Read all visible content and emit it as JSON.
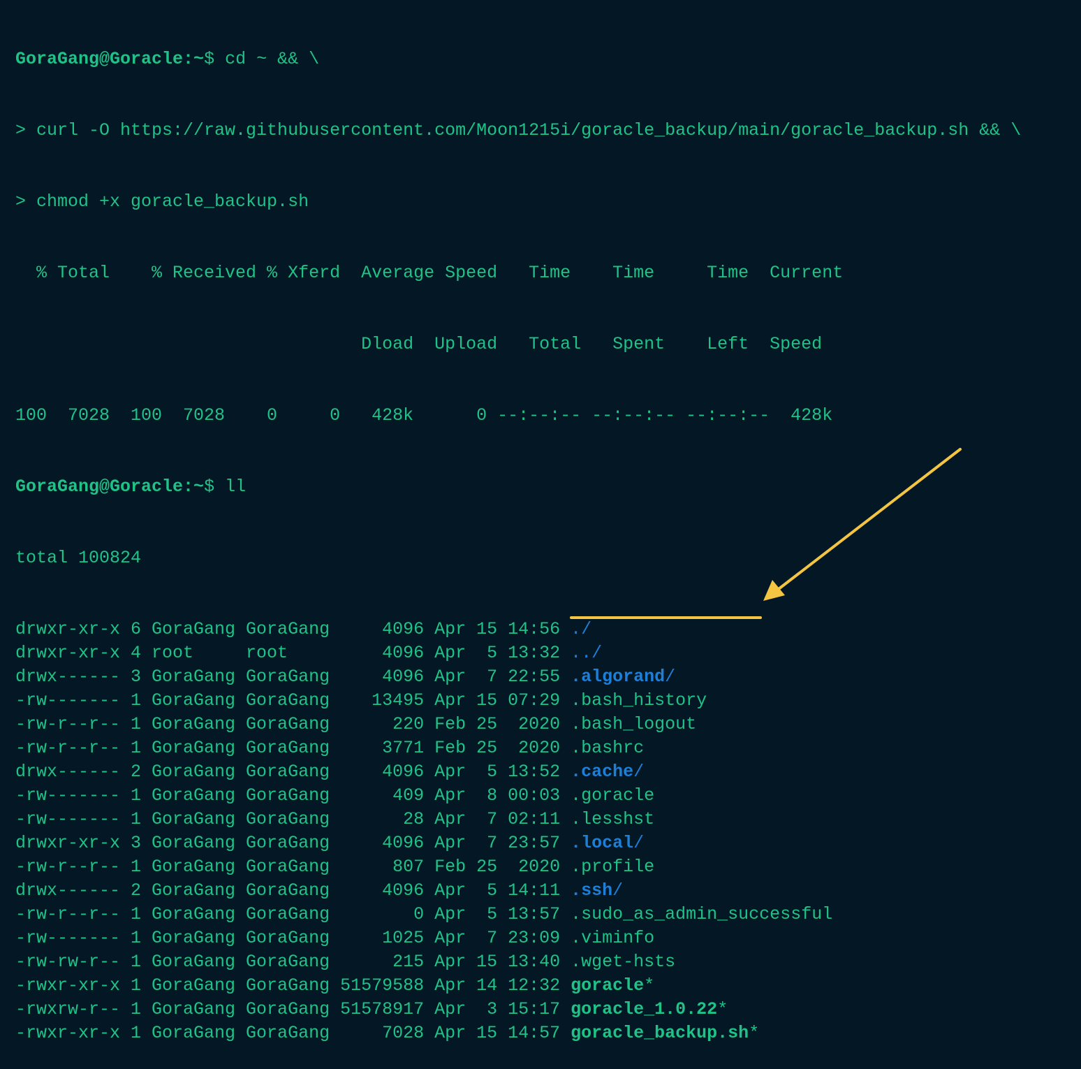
{
  "colors": {
    "background": "#031824",
    "text": "#1fc287",
    "directory": "#1e7fd8",
    "annotation": "#f4c542"
  },
  "prompt": {
    "userhost": "GoraGang@Goracle",
    "path": ":~",
    "symbol": "$ "
  },
  "commands": {
    "first": "cd ~ && \\",
    "continuation1": "> curl -O https://raw.githubusercontent.com/Moon1215i/goracle_backup/main/goracle_backup.sh && \\",
    "continuation2": "> chmod +x goracle_backup.sh",
    "second": "ll"
  },
  "curl_output": {
    "header1": "  % Total    % Received % Xferd  Average Speed   Time    Time     Time  Current",
    "header2": "                                 Dload  Upload   Total   Spent    Left  Speed",
    "progress": "100  7028  100  7028    0     0   428k      0 --:--:-- --:--:-- --:--:--  428k"
  },
  "listing": {
    "total": "total 100824",
    "entries": [
      {
        "meta": "drwxr-xr-x 6 GoraGang GoraGang     4096 Apr 15 14:56 ",
        "name": "./",
        "kind": "dirplain",
        "suffix": ""
      },
      {
        "meta": "drwxr-xr-x 4 root     root         4096 Apr  5 13:32 ",
        "name": "../",
        "kind": "dirplain",
        "suffix": ""
      },
      {
        "meta": "drwx------ 3 GoraGang GoraGang     4096 Apr  7 22:55 ",
        "name": ".algorand",
        "kind": "dir",
        "suffix": "/"
      },
      {
        "meta": "-rw------- 1 GoraGang GoraGang    13495 Apr 15 07:29 ",
        "name": ".bash_history",
        "kind": "normal",
        "suffix": ""
      },
      {
        "meta": "-rw-r--r-- 1 GoraGang GoraGang      220 Feb 25  2020 ",
        "name": ".bash_logout",
        "kind": "normal",
        "suffix": ""
      },
      {
        "meta": "-rw-r--r-- 1 GoraGang GoraGang     3771 Feb 25  2020 ",
        "name": ".bashrc",
        "kind": "normal",
        "suffix": ""
      },
      {
        "meta": "drwx------ 2 GoraGang GoraGang     4096 Apr  5 13:52 ",
        "name": ".cache",
        "kind": "dir",
        "suffix": "/"
      },
      {
        "meta": "-rw------- 1 GoraGang GoraGang      409 Apr  8 00:03 ",
        "name": ".goracle",
        "kind": "normal",
        "suffix": ""
      },
      {
        "meta": "-rw------- 1 GoraGang GoraGang       28 Apr  7 02:11 ",
        "name": ".lesshst",
        "kind": "normal",
        "suffix": ""
      },
      {
        "meta": "drwxr-xr-x 3 GoraGang GoraGang     4096 Apr  7 23:57 ",
        "name": ".local",
        "kind": "dir",
        "suffix": "/"
      },
      {
        "meta": "-rw-r--r-- 1 GoraGang GoraGang      807 Feb 25  2020 ",
        "name": ".profile",
        "kind": "normal",
        "suffix": ""
      },
      {
        "meta": "drwx------ 2 GoraGang GoraGang     4096 Apr  5 14:11 ",
        "name": ".ssh",
        "kind": "dir",
        "suffix": "/"
      },
      {
        "meta": "-rw-r--r-- 1 GoraGang GoraGang        0 Apr  5 13:57 ",
        "name": ".sudo_as_admin_successful",
        "kind": "normal",
        "suffix": ""
      },
      {
        "meta": "-rw------- 1 GoraGang GoraGang     1025 Apr  7 23:09 ",
        "name": ".viminfo",
        "kind": "normal",
        "suffix": ""
      },
      {
        "meta": "-rw-rw-r-- 1 GoraGang GoraGang      215 Apr 15 13:40 ",
        "name": ".wget-hsts",
        "kind": "normal",
        "suffix": ""
      },
      {
        "meta": "-rwxr-xr-x 1 GoraGang GoraGang 51579588 Apr 14 12:32 ",
        "name": "goracle",
        "kind": "exe",
        "suffix": "*"
      },
      {
        "meta": "-rwxrw-r-- 1 GoraGang GoraGang 51578917 Apr  3 15:17 ",
        "name": "goracle_1.0.22",
        "kind": "exe",
        "suffix": "*"
      },
      {
        "meta": "-rwxr-xr-x 1 GoraGang GoraGang     7028 Apr 15 14:57 ",
        "name": "goracle_backup.sh",
        "kind": "exe",
        "suffix": "*"
      }
    ]
  }
}
